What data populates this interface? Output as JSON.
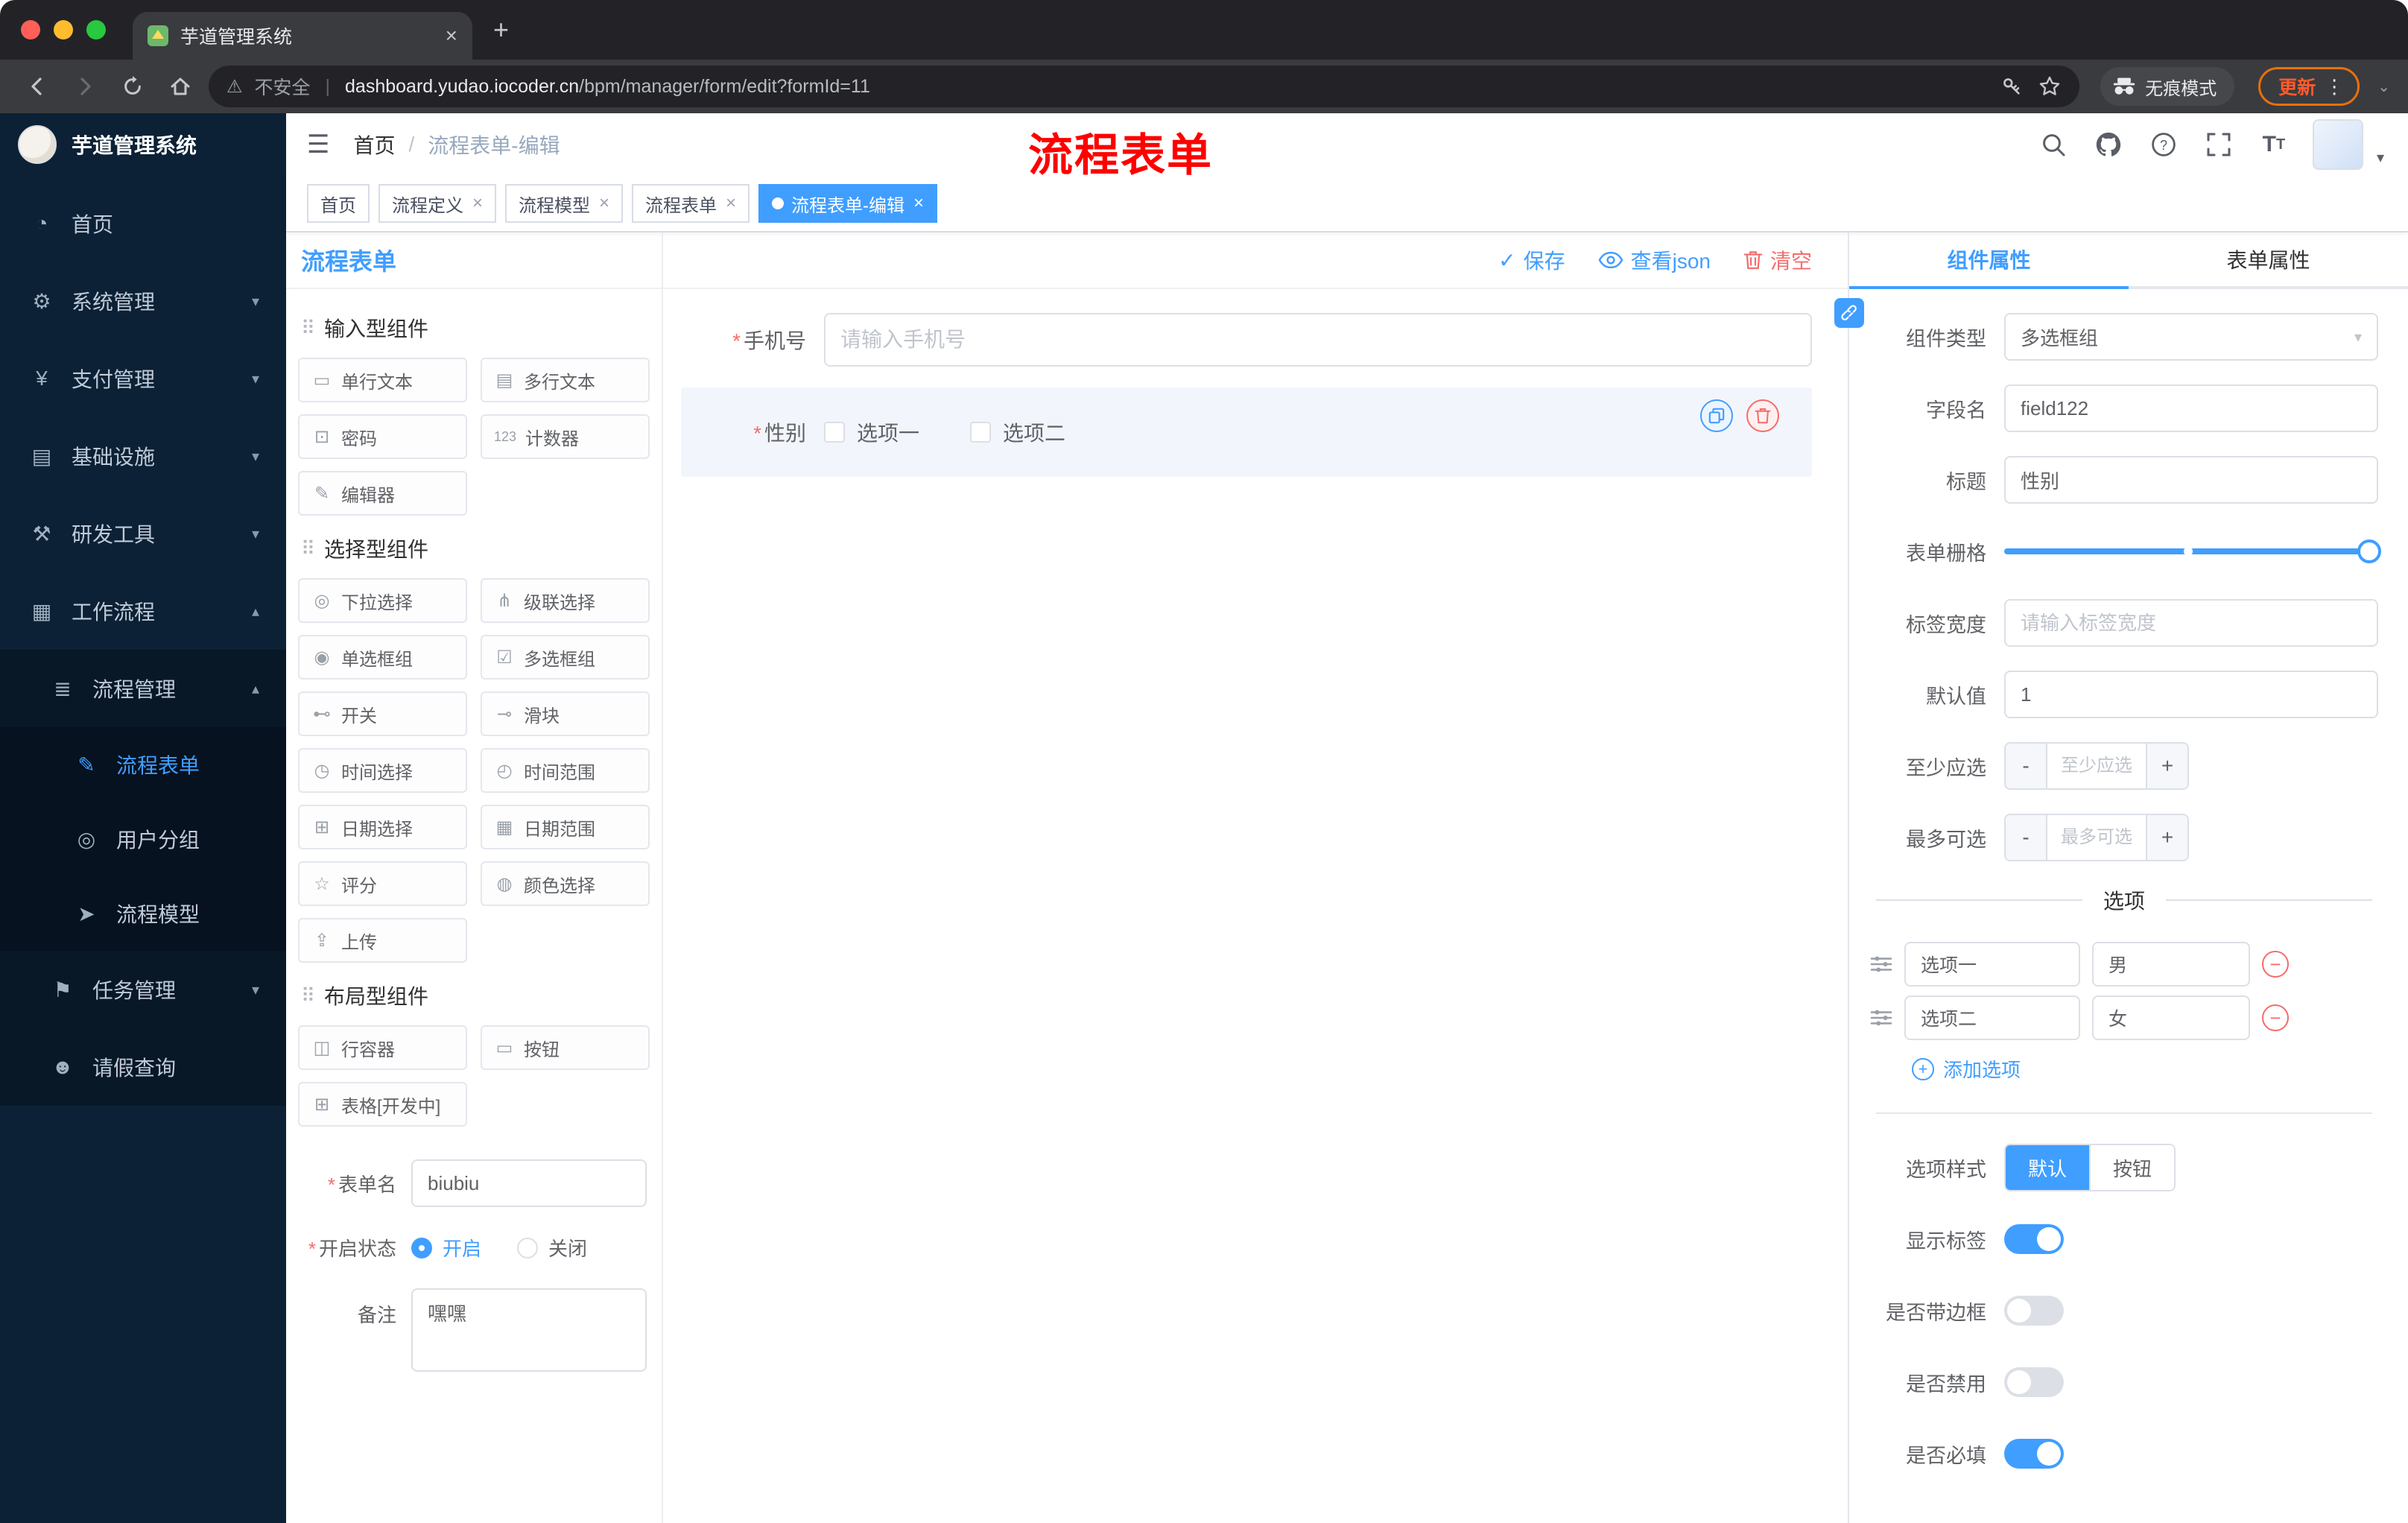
{
  "browser": {
    "tab_title": "芋道管理系统",
    "security_label": "不安全",
    "url_domain": "dashboard.yudao.iocoder.cn",
    "url_path": "/bpm/manager/form/edit?formId=11",
    "incognito_label": "无痕模式",
    "update_label": "更新"
  },
  "sidebar": {
    "logo_title": "芋道管理系统",
    "items": [
      {
        "icon": "◔",
        "label": "首页"
      },
      {
        "icon": "⚙",
        "label": "系统管理"
      },
      {
        "icon": "¥",
        "label": "支付管理"
      },
      {
        "icon": "▤",
        "label": "基础设施"
      },
      {
        "icon": "⚒",
        "label": "研发工具"
      },
      {
        "icon": "▦",
        "label": "工作流程"
      },
      {
        "icon": "≣",
        "label": "流程管理"
      },
      {
        "icon": "✎",
        "label": "流程表单"
      },
      {
        "icon": "◎",
        "label": "用户分组"
      },
      {
        "icon": "➤",
        "label": "流程模型"
      },
      {
        "icon": "⚑",
        "label": "任务管理"
      },
      {
        "icon": "☻",
        "label": "请假查询"
      }
    ]
  },
  "header": {
    "breadcrumb_home": "首页",
    "breadcrumb_separator": "/",
    "breadcrumb_current": "流程表单-编辑",
    "overlay_title": "流程表单"
  },
  "tags": {
    "items": [
      {
        "label": "首页"
      },
      {
        "label": "流程定义"
      },
      {
        "label": "流程模型"
      },
      {
        "label": "流程表单"
      },
      {
        "label": "流程表单-编辑"
      }
    ]
  },
  "palette": {
    "panel_title": "流程表单",
    "drag_glyph": "⠿",
    "sections": [
      {
        "title": "输入型组件",
        "icons": [
          "▭",
          "▤",
          "⊡",
          "123",
          "✎"
        ],
        "items": [
          "单行文本",
          "多行文本",
          "密码",
          "计数器",
          "编辑器"
        ]
      },
      {
        "title": "选择型组件",
        "icons": [
          "◎",
          "⋔",
          "◉",
          "☑",
          "⊷",
          "⊸",
          "◷",
          "◴",
          "⊞",
          "▦",
          "☆",
          "◍",
          "⇪"
        ],
        "items": [
          "下拉选择",
          "级联选择",
          "单选框组",
          "多选框组",
          "开关",
          "滑块",
          "时间选择",
          "时间范围",
          "日期选择",
          "日期范围",
          "评分",
          "颜色选择",
          "上传"
        ]
      },
      {
        "title": "布局型组件",
        "icons": [
          "◫",
          "▭",
          "⊞"
        ],
        "items": [
          "行容器",
          "按钮",
          "表格[开发中]"
        ]
      }
    ],
    "form": {
      "name_label": "表单名",
      "name_value": "biubiu",
      "status_label": "开启状态",
      "status_on": "开启",
      "status_off": "关闭",
      "status_selected": "开启",
      "remark_label": "备注",
      "remark_value": "嘿嘿"
    }
  },
  "canvas": {
    "toolbar": {
      "save": "保存",
      "view_json": "查看json",
      "clear": "清空"
    },
    "phone": {
      "label": "手机号",
      "placeholder": "请输入手机号"
    },
    "gender": {
      "label": "性别",
      "options": [
        "选项一",
        "选项二"
      ]
    }
  },
  "inspector": {
    "tabs": [
      "组件属性",
      "表单属性"
    ],
    "type_label": "组件类型",
    "type_value": "多选框组",
    "field_label": "字段名",
    "field_value": "field122",
    "title_label": "标题",
    "title_value": "性别",
    "grid_label": "表单栅格",
    "width_label": "标签宽度",
    "width_placeholder": "请输入标签宽度",
    "default_label": "默认值",
    "default_value": "1",
    "min_label": "至少应选",
    "min_placeholder": "至少应选",
    "max_label": "最多可选",
    "max_placeholder": "最多可选",
    "stepper_minus": "-",
    "stepper_plus": "+",
    "options_title": "选项",
    "options": [
      {
        "label": "选项一",
        "value": "男"
      },
      {
        "label": "选项二",
        "value": "女"
      }
    ],
    "add_option": "添加选项",
    "style_label": "选项样式",
    "style_options": [
      "默认",
      "按钮"
    ],
    "style_selected": "默认",
    "toggles": [
      {
        "label": "显示标签",
        "on": true
      },
      {
        "label": "是否带边框",
        "on": false
      },
      {
        "label": "是否禁用",
        "on": false
      },
      {
        "label": "是否必填",
        "on": true
      }
    ]
  },
  "colors": {
    "primary": "#409eff",
    "danger": "#f56c6c",
    "annotation_red": "#fd0000"
  }
}
